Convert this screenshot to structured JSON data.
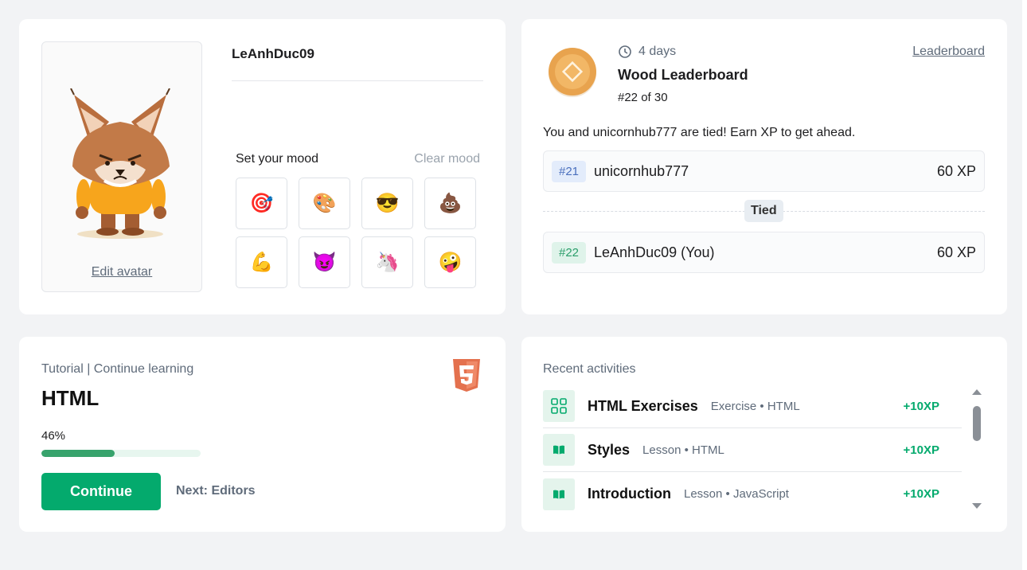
{
  "profile": {
    "username": "LeAnhDuc09",
    "edit_avatar": "Edit avatar",
    "mood_title": "Set your mood",
    "clear_mood": "Clear mood",
    "moods": [
      {
        "name": "target-emoji",
        "glyph": "🎯"
      },
      {
        "name": "palette-emoji",
        "glyph": "🎨"
      },
      {
        "name": "sunglasses-emoji",
        "glyph": "😎"
      },
      {
        "name": "poop-emoji",
        "glyph": "💩"
      },
      {
        "name": "flexed-biceps-emoji",
        "glyph": "💪"
      },
      {
        "name": "smiling-devil-emoji",
        "glyph": "😈"
      },
      {
        "name": "unicorn-emoji",
        "glyph": "🦄"
      },
      {
        "name": "zany-face-emoji",
        "glyph": "🤪"
      }
    ]
  },
  "leaderboard": {
    "days": "4 days",
    "title": "Wood Leaderboard",
    "rank": "#22 of 30",
    "link": "Leaderboard",
    "message": "You and unicornhub777 are tied! Earn XP to get ahead.",
    "tied_label": "Tied",
    "rows": [
      {
        "rank": "#21",
        "name": "unicornhub777",
        "xp": "60 XP"
      },
      {
        "rank": "#22",
        "name": "LeAnhDuc09 (You)",
        "xp": "60 XP"
      }
    ],
    "colors": {
      "medal": "#e8a34e",
      "current_user_badge": "#2a9d6a",
      "other_badge": "#4a6fbd"
    }
  },
  "tutorial": {
    "label": "Tutorial | Continue learning",
    "title": "HTML",
    "progress_text": "46%",
    "progress": 0.46,
    "continue_label": "Continue",
    "next_label": "Next: Editors",
    "icon": "html5-icon",
    "colors": {
      "button": "#04aa6d",
      "progress": "#37a36c",
      "html5": "#e4714e"
    }
  },
  "activities": {
    "label": "Recent activities",
    "items": [
      {
        "icon": "exercise-grid-icon",
        "title": "HTML Exercises",
        "meta": "Exercise • HTML",
        "xp": "+10XP"
      },
      {
        "icon": "book-icon",
        "title": "Styles",
        "meta": "Lesson • HTML",
        "xp": "+10XP"
      },
      {
        "icon": "book-icon",
        "title": "Introduction",
        "meta": "Lesson • JavaScript",
        "xp": "+10XP"
      }
    ]
  }
}
